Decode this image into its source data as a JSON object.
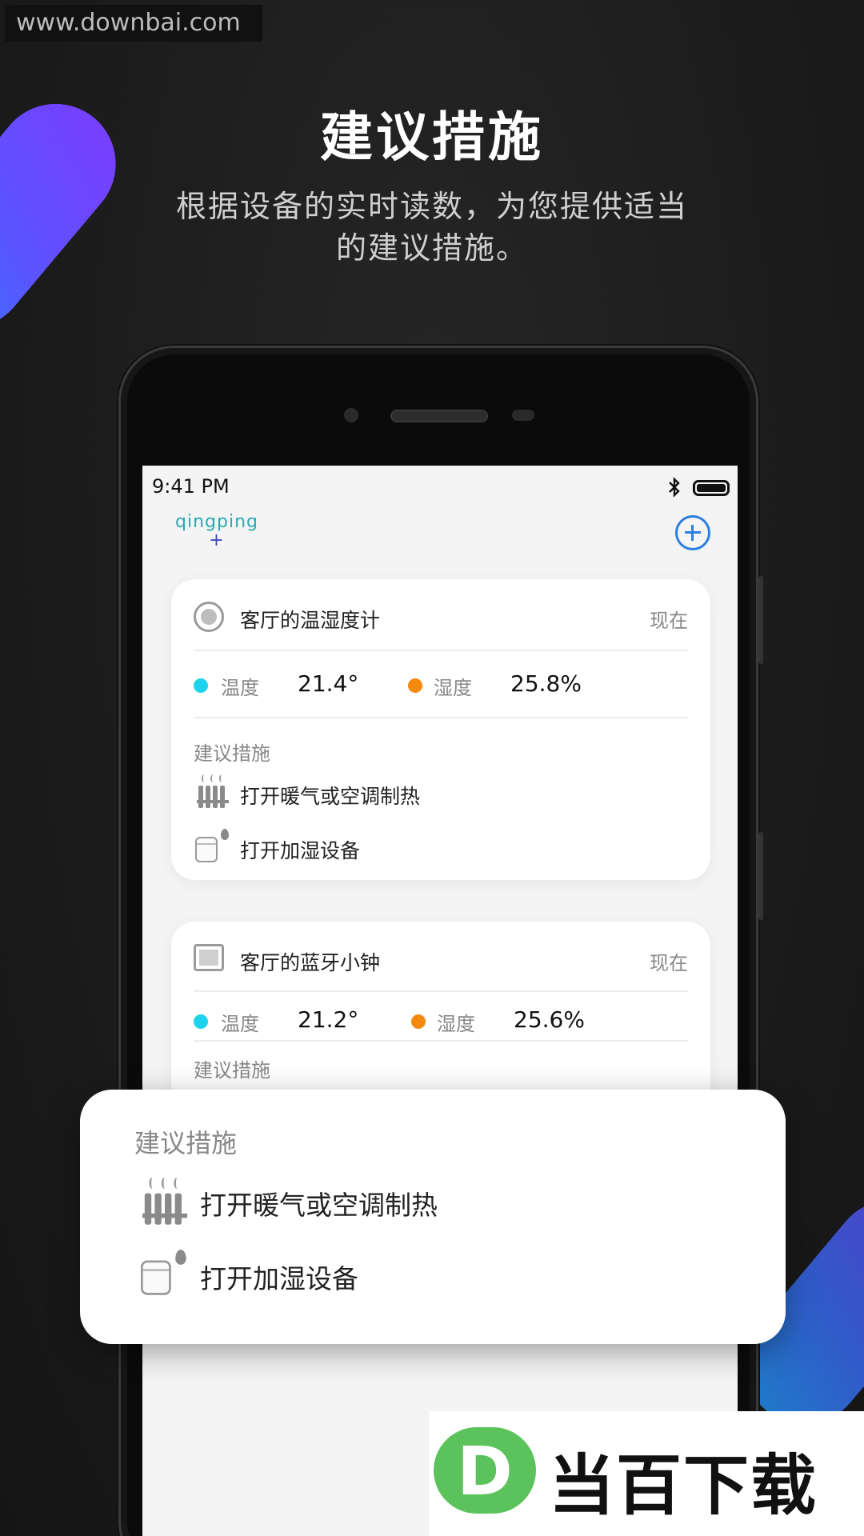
{
  "watermark": {
    "url": "www.downbai.com",
    "brand_letter": "D",
    "brand_name": "当百下载"
  },
  "hero": {
    "title": "建议措施",
    "subtitle": "根据设备的实时读数，为您提供适当的建议措施。"
  },
  "status_bar": {
    "time": "9:41 PM",
    "icons": [
      "bluetooth-icon",
      "battery-icon"
    ]
  },
  "app": {
    "logo_text": "qingping",
    "logo_plus": "+",
    "add_icon": "plus-circle-icon"
  },
  "cards": [
    {
      "device_icon": "thermo-hygrometer-icon",
      "name": "客厅的温湿度计",
      "time": "现在",
      "temperature_label": "温度",
      "temperature_value": "21.4°",
      "humidity_label": "湿度",
      "humidity_value": "25.8%",
      "suggest_title": "建议措施",
      "suggestions": [
        {
          "icon": "radiator-icon",
          "text": "打开暖气或空调制热"
        },
        {
          "icon": "humidifier-icon",
          "text": "打开加湿设备"
        }
      ]
    },
    {
      "device_icon": "bluetooth-clock-icon",
      "name": "客厅的蓝牙小钟",
      "time": "现在",
      "temperature_label": "温度",
      "temperature_value": "21.2°",
      "humidity_label": "湿度",
      "humidity_value": "25.6%",
      "suggest_title": "建议措施"
    }
  ],
  "popup": {
    "title": "建议措施",
    "suggestions": [
      {
        "icon": "radiator-icon",
        "text": "打开暖气或空调制热"
      },
      {
        "icon": "humidifier-icon",
        "text": "打开加湿设备"
      }
    ]
  },
  "colors": {
    "temperature_dot": "#1fd2ec",
    "humidity_dot": "#f5880f",
    "accent_blue": "#2a7fe0",
    "logo_teal": "#2aa9b3",
    "brand_green": "#5cc35c"
  }
}
